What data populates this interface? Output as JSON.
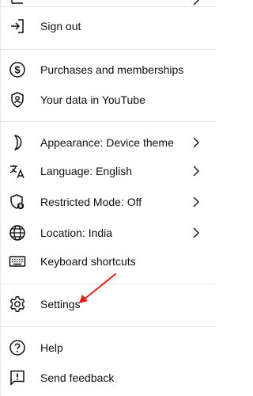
{
  "menu": {
    "items": [
      {
        "label": "Sign out",
        "icon": "sign-out-icon"
      },
      {
        "label": "Purchases and memberships",
        "icon": "dollar-circle-icon"
      },
      {
        "label": "Your data in YouTube",
        "icon": "shield-person-icon"
      },
      {
        "label": "Appearance: Device theme",
        "icon": "moon-icon",
        "has_submenu": true
      },
      {
        "label": "Language: English",
        "icon": "translate-icon",
        "has_submenu": true
      },
      {
        "label": "Restricted Mode: Off",
        "icon": "restricted-shield-icon",
        "has_submenu": true
      },
      {
        "label": "Location: India",
        "icon": "globe-icon",
        "has_submenu": true
      },
      {
        "label": "Keyboard shortcuts",
        "icon": "keyboard-icon"
      },
      {
        "label": "Settings",
        "icon": "gear-icon"
      },
      {
        "label": "Help",
        "icon": "help-icon"
      },
      {
        "label": "Send feedback",
        "icon": "feedback-icon"
      }
    ]
  },
  "annotation": {
    "color": "#e0201b",
    "points_to": "Settings"
  }
}
